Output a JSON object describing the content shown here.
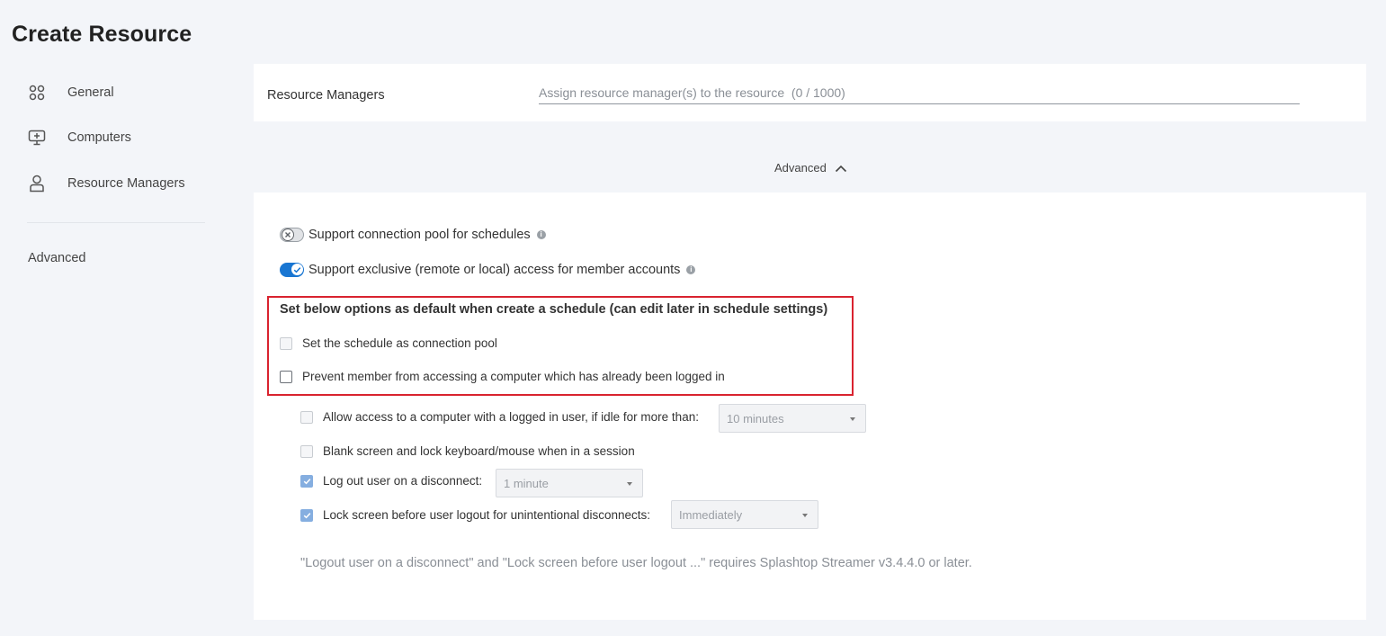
{
  "page": {
    "title": "Create Resource"
  },
  "sidebar": {
    "items": [
      {
        "label": "General",
        "icon": "grid-icon"
      },
      {
        "label": "Computers",
        "icon": "monitor-add-icon"
      },
      {
        "label": "Resource Managers",
        "icon": "user-icon"
      }
    ],
    "advanced_label": "Advanced"
  },
  "managers": {
    "label": "Resource Managers",
    "placeholder": "Assign resource manager(s) to the resource  (0 / 1000)"
  },
  "advanced_toggle": {
    "label": "Advanced",
    "icon": "chevron-up-icon",
    "expanded": true
  },
  "switches": [
    {
      "label": "Support connection pool for schedules",
      "on": false
    },
    {
      "label": "Support exclusive (remote or local) access for member accounts",
      "on": true
    }
  ],
  "defaults": {
    "title": "Set below options as default when create a schedule (can edit later in schedule settings)",
    "options": [
      {
        "label": "Set the schedule as connection pool",
        "checked": false,
        "enabled": false
      },
      {
        "label": "Prevent member from accessing a computer which has already been logged in",
        "checked": false,
        "enabled": true
      }
    ]
  },
  "sub_options": [
    {
      "label": "Allow access to a computer with a logged in user, if idle for more than:",
      "checked": false,
      "select": "10 minutes"
    },
    {
      "label": "Blank screen and lock keyboard/mouse when in a session",
      "checked": false
    },
    {
      "label": "Log out user on a disconnect:",
      "checked": true,
      "select": "1 minute"
    },
    {
      "label": "Lock screen before user logout for unintentional disconnects:",
      "checked": true,
      "select": "Immediately"
    }
  ],
  "note": "\"Logout user on a disconnect\" and \"Lock screen before user logout ...\" requires Splashtop Streamer v3.4.4.0 or later.",
  "colors": {
    "accent": "#1976d2",
    "highlight_border": "#d9232f",
    "checked_disabled": "#85aee0"
  }
}
